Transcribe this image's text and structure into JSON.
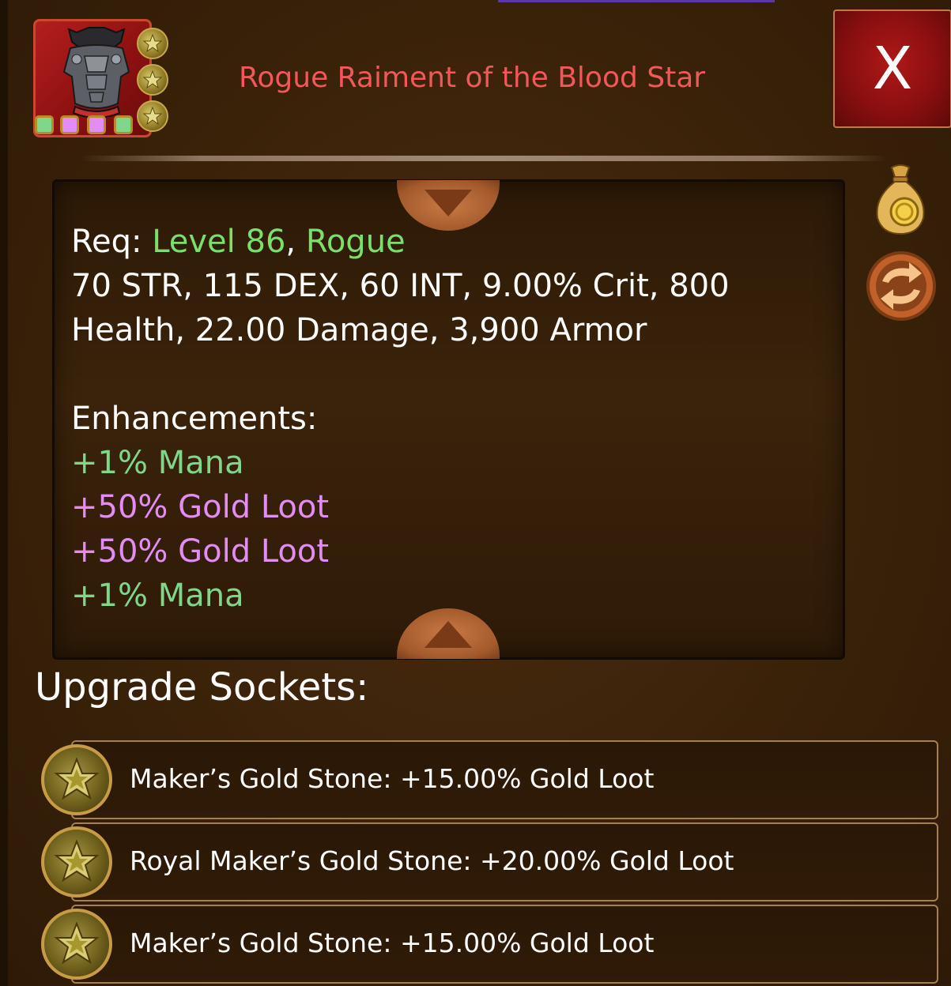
{
  "item": {
    "title": "Rogue Raiment of the Blood Star",
    "icon": "rogue-armor-icon",
    "star_badges": 3,
    "gem_colors": [
      "#7fd88a",
      "#e28cf4",
      "#e28cf4",
      "#7fd88a"
    ],
    "title_color": "#f0585a"
  },
  "close_button": {
    "label": "X"
  },
  "description": {
    "req_label": "Req: ",
    "req_level": "Level 86",
    "req_sep": ", ",
    "req_class": "Rogue",
    "stats_line1": "70 STR, 115 DEX, 60 INT, 9.00% Crit, 800",
    "stats_line2": "Health, 22.00 Damage, 3,900 Armor",
    "enhancements_label": "Enhancements:",
    "enhancements": [
      {
        "text": "+1% Mana",
        "color": "green"
      },
      {
        "text": "+50% Gold Loot",
        "color": "pink"
      },
      {
        "text": "+50% Gold Loot",
        "color": "pink"
      },
      {
        "text": "+1% Mana",
        "color": "green"
      }
    ]
  },
  "side_actions": [
    {
      "name": "gold-bag-icon"
    },
    {
      "name": "swap-arrows-icon"
    }
  ],
  "sockets": {
    "title": "Upgrade Sockets:",
    "items": [
      {
        "text": "Maker’s Gold Stone: +15.00% Gold Loot"
      },
      {
        "text": "Royal Maker’s Gold Stone: +20.00% Gold Loot"
      },
      {
        "text": "Maker’s Gold Stone: +15.00% Gold Loot"
      }
    ]
  }
}
